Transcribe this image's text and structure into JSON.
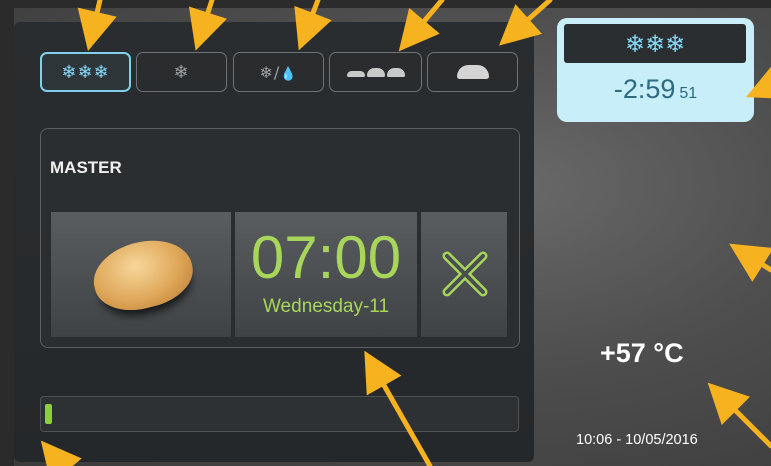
{
  "modes": [
    {
      "id": "deep-freeze",
      "icon": "❄❄❄",
      "active": true
    },
    {
      "id": "freeze",
      "icon": "❄",
      "active": false
    },
    {
      "id": "defrost",
      "icon": "❄/💧",
      "active": false
    },
    {
      "id": "proving",
      "icon": "small-loaves-icon",
      "active": false
    },
    {
      "id": "bake",
      "icon": "loaf-icon",
      "active": false
    }
  ],
  "program": {
    "name": "MASTER",
    "time": "07:00",
    "day": "Wednesday-11"
  },
  "progress": 0.015,
  "status": {
    "mode_icon": "❄❄❄",
    "timer": "-2:59",
    "seconds": "51"
  },
  "temperature": "+57 °C",
  "datetime": "10:06 - 10/05/2016",
  "colors": {
    "accent_blue": "#86d8f5",
    "lime": "#a8d65a",
    "arrow": "#f6b21f"
  }
}
